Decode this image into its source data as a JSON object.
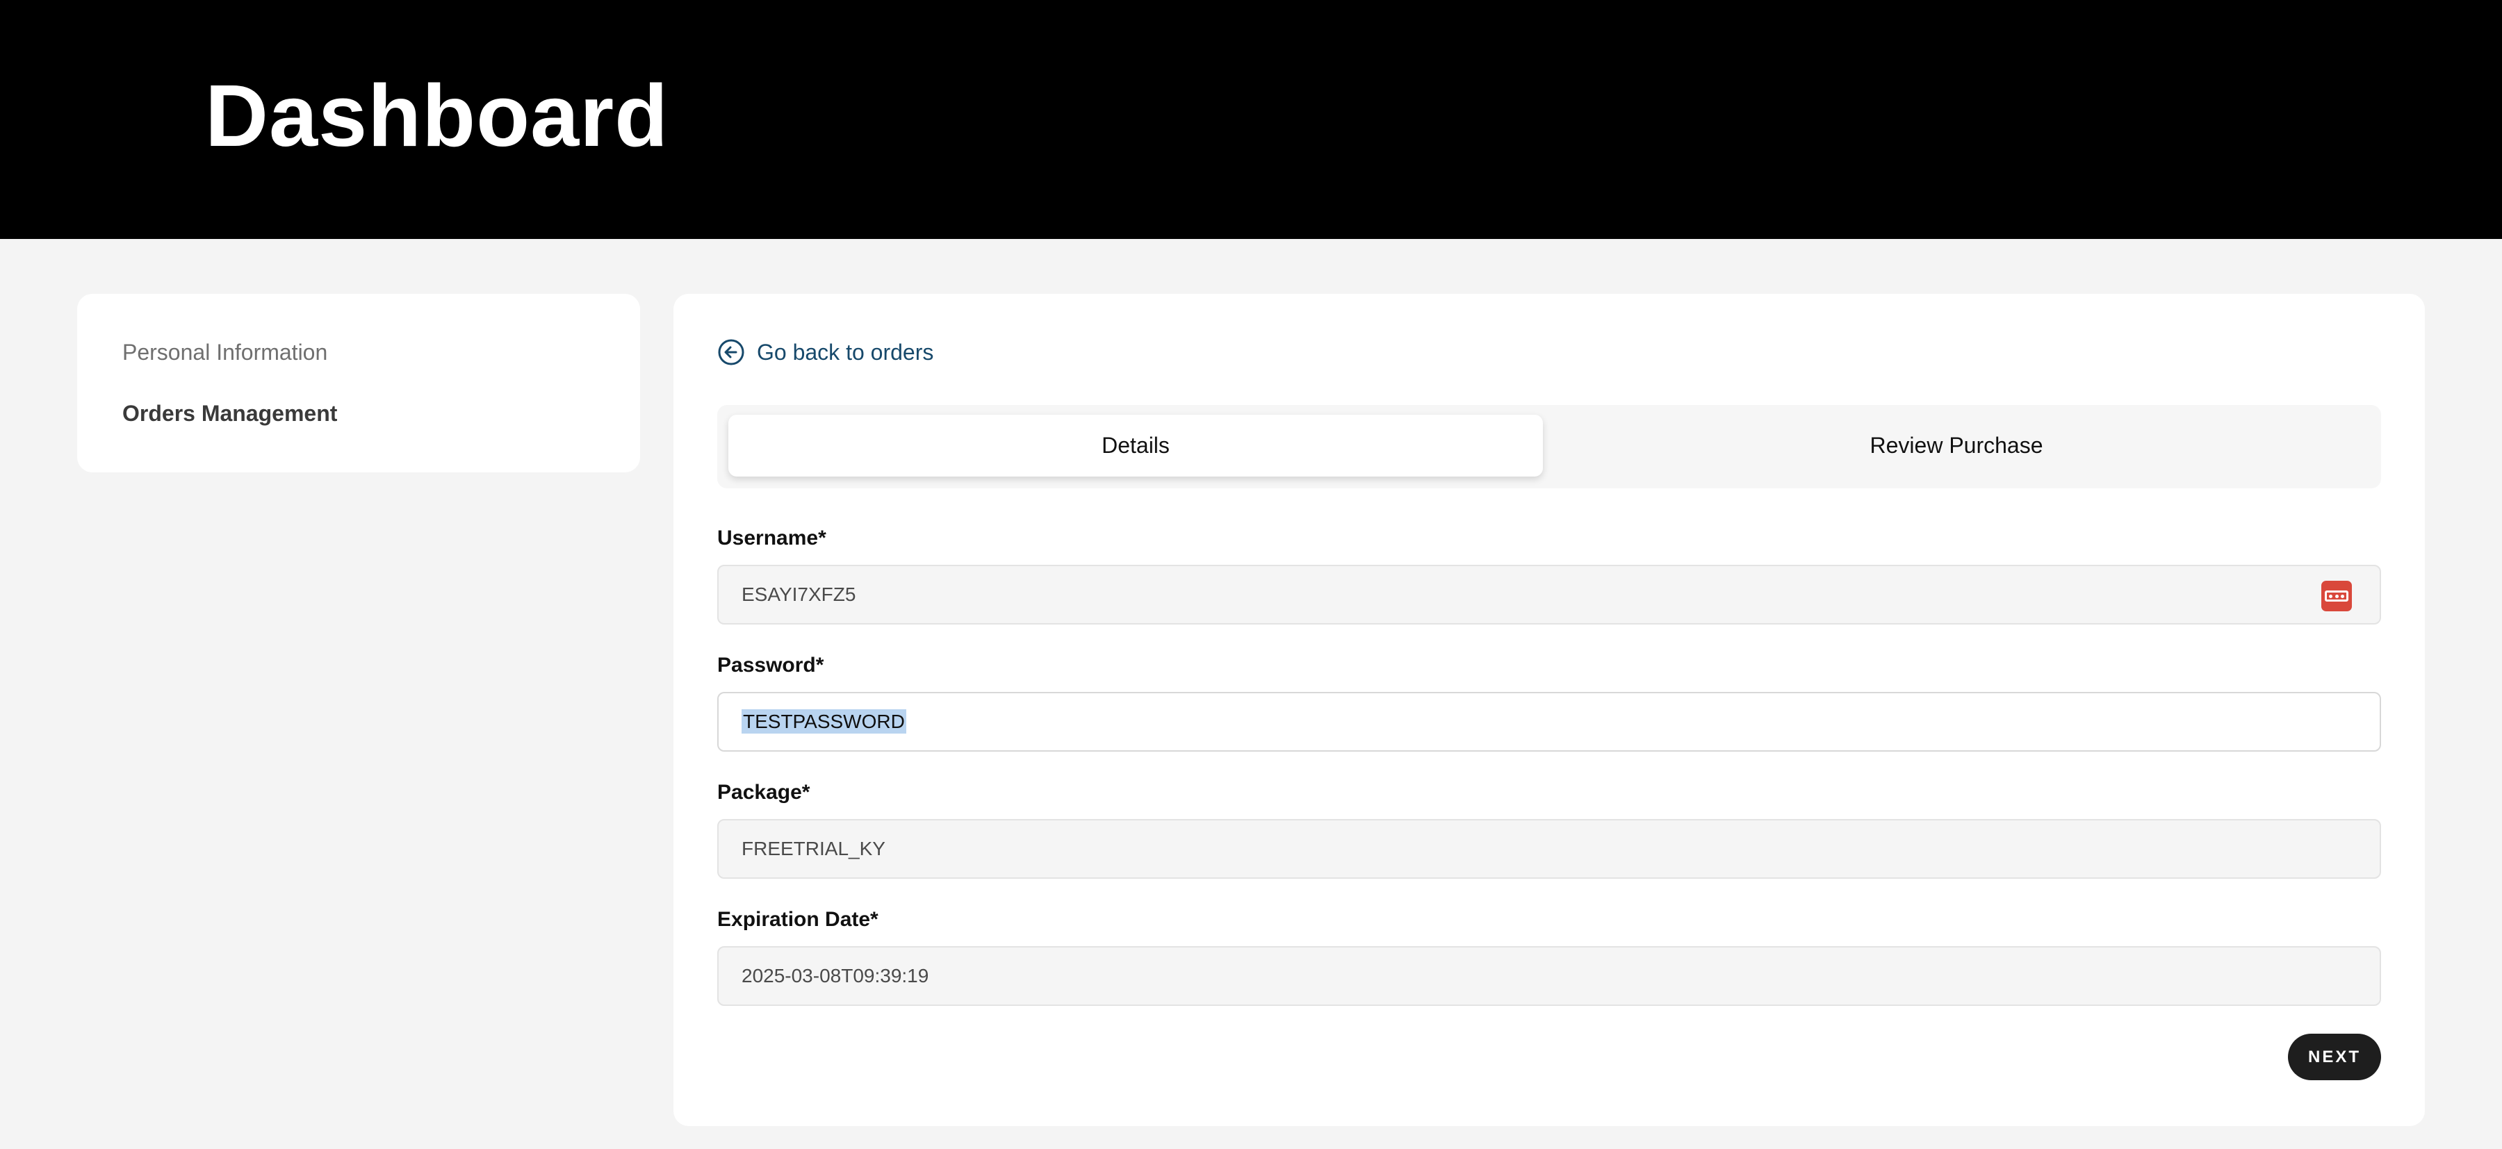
{
  "header": {
    "title": "Dashboard"
  },
  "sidebar": {
    "items": [
      {
        "label": "Personal Information",
        "active": false
      },
      {
        "label": "Orders Management",
        "active": true
      }
    ]
  },
  "main": {
    "back_link": "Go back to orders",
    "tabs": [
      {
        "label": "Details",
        "active": true
      },
      {
        "label": "Review Purchase",
        "active": false
      }
    ],
    "fields": {
      "username": {
        "label": "Username*",
        "value": "ESAYI7XFZ5"
      },
      "password": {
        "label": "Password*",
        "value": "TESTPASSWORD"
      },
      "package": {
        "label": "Package*",
        "value": "FREETRIAL_KY"
      },
      "expiration": {
        "label": "Expiration Date*",
        "value": "2025-03-08T09:39:19"
      }
    },
    "next_button": "NEXT"
  },
  "colors": {
    "header_bg": "#000000",
    "link": "#17496b",
    "button_bg": "#1e1e1e",
    "password_manager_icon": "#d9483b",
    "selection": "#b9d4f0"
  }
}
